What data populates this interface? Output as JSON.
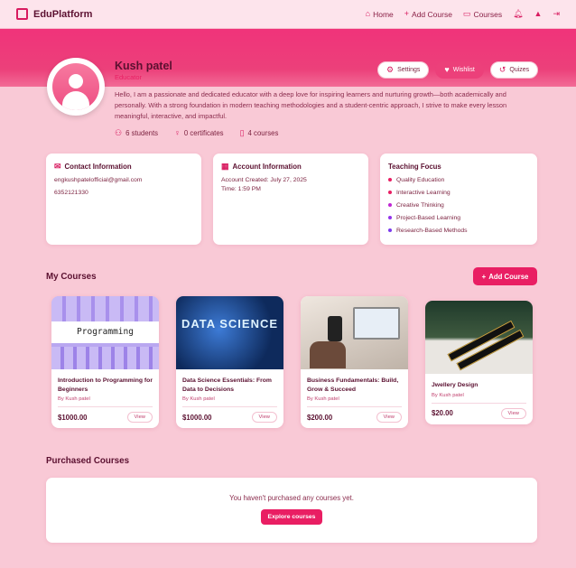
{
  "nav": {
    "brand": "EduPlatform",
    "home": "Home",
    "add_course": "Add Course",
    "courses": "Courses"
  },
  "profile": {
    "name": "Kush patel",
    "role": "Educator",
    "bio": "Hello, I am a passionate and dedicated educator with a deep love for inspiring learners and nurturing growth—both academically and personally. With a strong foundation in modern teaching methodologies and a student-centric approach, I strive to make every lesson meaningful, interactive, and impactful.",
    "buttons": {
      "settings": "Settings",
      "wishlist": "Wishlist",
      "quizes": "Quizes"
    },
    "stats": {
      "students": "6 students",
      "certificates": "0 certificates",
      "courses": "4 courses"
    }
  },
  "contact": {
    "title": "Contact Information",
    "email": "engkushpatelofficial@gmail.com",
    "phone": "6352121330"
  },
  "account": {
    "title": "Account Information",
    "created": "Account Created: July 27, 2025",
    "time": "Time: 1:59 PM"
  },
  "teaching": {
    "title": "Teaching Focus",
    "items": [
      "Quality Education",
      "Interactive Learning",
      "Creative Thinking",
      "Project-Based Learning",
      "Research-Based Methods"
    ],
    "colors": [
      "#e91e63",
      "#e91e63",
      "#c026d3",
      "#9333ea",
      "#7c3aed"
    ]
  },
  "my_courses": {
    "title": "My Courses",
    "add_label": "Add Course",
    "items": [
      {
        "title": "Introduction to Programming for Beginners",
        "by": "By Kush patel",
        "price": "$1000.00",
        "view": "View",
        "image_text": "Programming"
      },
      {
        "title": "Data Science Essentials: From Data to Decisions",
        "by": "By Kush patel",
        "price": "$1000.00",
        "view": "View",
        "image_text": "DATA SCIENCE"
      },
      {
        "title": "Business Fundamentals: Build, Grow & Succeed",
        "by": "By Kush patel",
        "price": "$200.00",
        "view": "View"
      },
      {
        "title": "Jwellery Design",
        "by": "By Kush patel",
        "price": "$20.00",
        "view": "View"
      }
    ]
  },
  "purchased": {
    "title": "Purchased Courses",
    "empty_text": "You haven't purchased any courses yet.",
    "explore_label": "Explore courses"
  },
  "colors": {
    "accent": "#e91e63",
    "background": "#f9c9d6",
    "text": "#5b1030"
  }
}
